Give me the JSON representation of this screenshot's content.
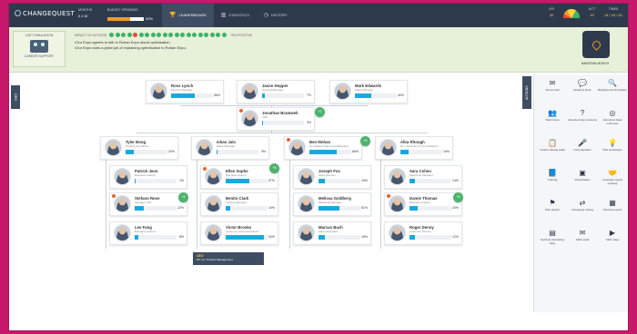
{
  "topbar": {
    "logo": "CHANGEQUEST",
    "stats": [
      {
        "label": "MONTHS",
        "value": "0.1 M"
      },
      {
        "label": "BUDGET SPENDING",
        "value": "53%"
      }
    ],
    "budget_fraction": 0.62,
    "tabs": [
      {
        "label": "LEADERBOARD",
        "icon": "trophy-icon",
        "active": true
      },
      {
        "label": "STATISTICS",
        "icon": "chart-icon",
        "active": false
      },
      {
        "label": "HISTORY",
        "icon": "clock-icon",
        "active": false
      }
    ],
    "right": [
      {
        "label": "KPI",
        "value": "42"
      },
      {
        "label": "ACT",
        "value": "19"
      },
      {
        "label": "TIMES",
        "value": "14 / 16 / 41"
      }
    ]
  },
  "impact": {
    "last_card_label": "LAST SIMULATION",
    "last_card_sub": "CAREER SUPPORT",
    "impact_label": "IMPACT OF ACTIONS:",
    "dots_after": "+5% POSITIVE",
    "dot_colors": [
      "#3ab46a",
      "#3ab46a",
      "#3ab46a",
      "#3ab46a",
      "#e64b3c",
      "#3ab46a",
      "#3ab46a",
      "#3ab46a",
      "#3ab46a",
      "#3ab46a",
      "#3ab46a",
      "#3ab46a",
      "#3ab46a",
      "#3ab46a",
      "#3ab46a",
      "#3ab46a",
      "#3ab46a",
      "#3ab46a",
      "#3ab46a",
      "#3ab46a"
    ],
    "feedback": [
      "•Our Expo agrees to talk to Rohan Expo about optimisation",
      "•Our Expo does a great job of explaining optimisation to Rohan Expo."
    ],
    "milestone_label": "MAINTAIN MONTH"
  },
  "side_tabs": {
    "left": "ORG",
    "right": "ACTIONS"
  },
  "people": [
    {
      "name": "Ross Lynch",
      "title": "Finance Manager",
      "pct": "56%",
      "fill": 0.56
    },
    {
      "name": "Jason Hopper",
      "title": "General Manager",
      "pct": "7%",
      "fill": 0.07
    },
    {
      "name": "Mark Edwards",
      "title": "Sales Manager",
      "pct": "40%",
      "fill": 0.4
    },
    {
      "name": "Jonathan Bramweh",
      "title": "CEO",
      "pct": "3%",
      "fill": 0.03
    },
    {
      "name": "Tyler Bong",
      "title": "Product Operations",
      "pct": "20%",
      "fill": 0.2
    },
    {
      "name": "Ishan Jain",
      "title": "Sales Manager",
      "pct": "3%",
      "fill": 0.03
    },
    {
      "name": "Ben Mohan",
      "title": "Dir. Market Sales and Marketing",
      "pct": "66%",
      "fill": 0.66
    },
    {
      "name": "Alba Rhough",
      "title": "Dir. Customer Communications",
      "pct": "19%",
      "fill": 0.19
    },
    {
      "name": "Patrick Jeon",
      "title": "Business Analyst",
      "pct": "1%",
      "fill": 0.01
    },
    {
      "name": "Ellen Sophe",
      "title": "Business Analyst",
      "pct": "57%",
      "fill": 0.57
    },
    {
      "name": "Joseph Fox",
      "title": "Sales Director",
      "pct": "15%",
      "fill": 0.15
    },
    {
      "name": "Sara Cohen",
      "title": "Marketing Manager",
      "pct": "13%",
      "fill": 0.13
    },
    {
      "name": "Stefano Rose",
      "title": "Manager, CIP",
      "pct": "22%",
      "fill": 0.22
    },
    {
      "name": "Benito Clark",
      "title": "Product Manager",
      "pct": "10%",
      "fill": 0.1
    },
    {
      "name": "Melissa Goldberg",
      "title": "Marketing Manager",
      "pct": "51%",
      "fill": 0.51
    },
    {
      "name": "Damie Thomas",
      "title": "Business Analyst",
      "pct": "20%",
      "fill": 0.2
    },
    {
      "name": "Lee Fang",
      "title": "Business Analyst",
      "pct": "8%",
      "fill": 0.08
    },
    {
      "name": "Victor Brooks",
      "title": "Customer Communications",
      "pct": "92%",
      "fill": 0.92
    },
    {
      "name": "Marcus Bach",
      "title": "Sales Associate",
      "pct": "15%",
      "fill": 0.15
    },
    {
      "name": "Roger Denny",
      "title": "Customer Service",
      "pct": "12%",
      "fill": 0.12
    }
  ],
  "badges": [
    "+2",
    "+5",
    "+5",
    "+4",
    "+5",
    "+3"
  ],
  "dark_box": {
    "title": "CEO",
    "text": "Dir. Inc. Product Management"
  },
  "actions": [
    {
      "label": "Send email",
      "icon": "email-icon"
    },
    {
      "label": "Speak to Ross",
      "icon": "chat-icon"
    },
    {
      "label": "Background information",
      "icon": "search-icon"
    },
    {
      "label": "Task forces",
      "icon": "team-icon"
    },
    {
      "label": "Ask about key concerns",
      "icon": "question-icon"
    },
    {
      "label": "Ask about ideal outcomes",
      "icon": "target-icon"
    },
    {
      "label": "Culture climate audit",
      "icon": "clipboard-icon"
    },
    {
      "label": "Invite Speaker",
      "icon": "speaker-icon"
    },
    {
      "label": "Pilot workshops",
      "icon": "lightbulb-icon"
    },
    {
      "label": "Training",
      "icon": "book-icon"
    },
    {
      "label": "Presentation",
      "icon": "presentation-icon"
    },
    {
      "label": "Leverage impact meeting",
      "icon": "handshake-icon"
    },
    {
      "label": "Pilot project",
      "icon": "flag-icon"
    },
    {
      "label": "Increasing routing",
      "icon": "route-icon"
    },
    {
      "label": "Informal events",
      "icon": "calendar-icon"
    },
    {
      "label": "Send an interesting blog",
      "icon": "document-icon"
    },
    {
      "label": "CEO email",
      "icon": "mail-icon"
    },
    {
      "label": "CEO video",
      "icon": "video-icon"
    }
  ]
}
